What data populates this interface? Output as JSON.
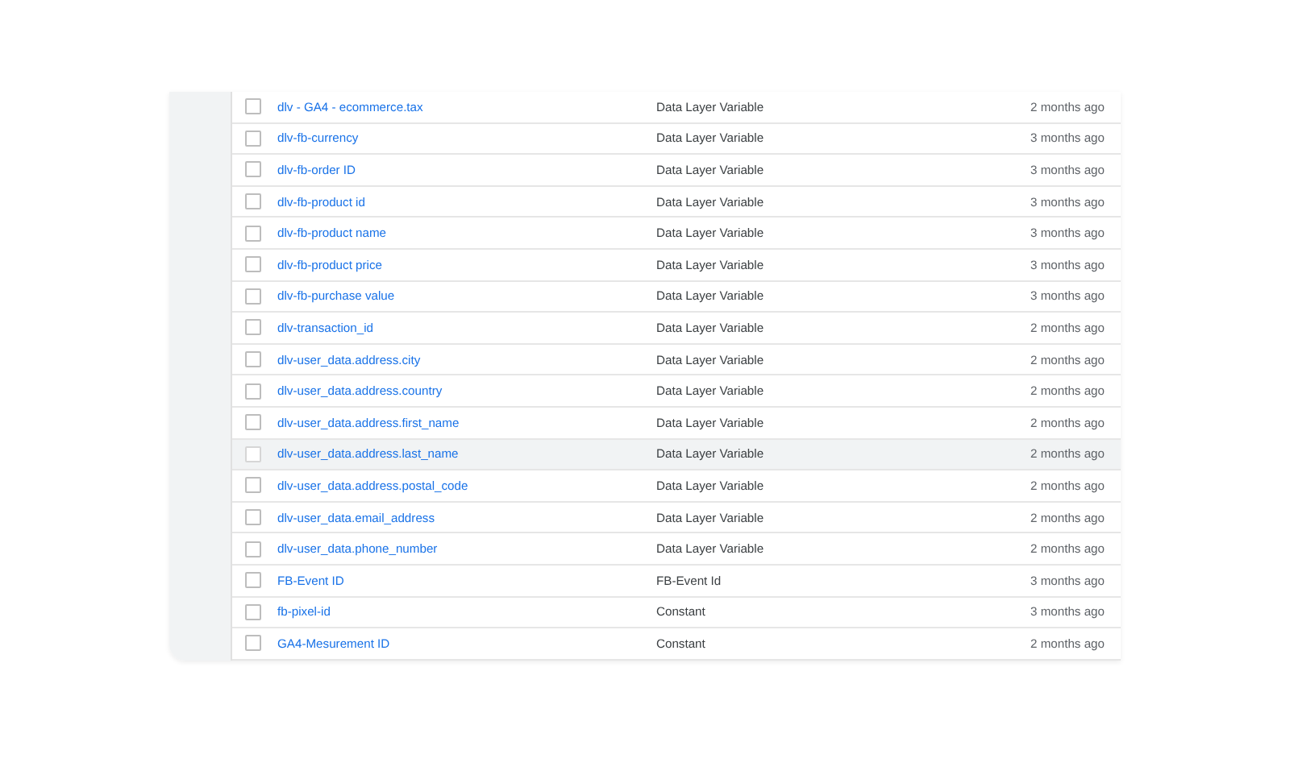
{
  "variables": [
    {
      "name": "dlv - GA4 - ecommerce.tax",
      "type": "Data Layer Variable",
      "edited": "2 months ago",
      "checked": false,
      "highlighted": false
    },
    {
      "name": "dlv-fb-currency",
      "type": "Data Layer Variable",
      "edited": "3 months ago",
      "checked": false,
      "highlighted": false
    },
    {
      "name": "dlv-fb-order ID",
      "type": "Data Layer Variable",
      "edited": "3 months ago",
      "checked": false,
      "highlighted": false
    },
    {
      "name": "dlv-fb-product id",
      "type": "Data Layer Variable",
      "edited": "3 months ago",
      "checked": false,
      "highlighted": false
    },
    {
      "name": "dlv-fb-product name",
      "type": "Data Layer Variable",
      "edited": "3 months ago",
      "checked": false,
      "highlighted": false
    },
    {
      "name": "dlv-fb-product price",
      "type": "Data Layer Variable",
      "edited": "3 months ago",
      "checked": false,
      "highlighted": false
    },
    {
      "name": "dlv-fb-purchase value",
      "type": "Data Layer Variable",
      "edited": "3 months ago",
      "checked": false,
      "highlighted": false
    },
    {
      "name": "dlv-transaction_id",
      "type": "Data Layer Variable",
      "edited": "2 months ago",
      "checked": false,
      "highlighted": false
    },
    {
      "name": "dlv-user_data.address.city",
      "type": "Data Layer Variable",
      "edited": "2 months ago",
      "checked": false,
      "highlighted": false
    },
    {
      "name": "dlv-user_data.address.country",
      "type": "Data Layer Variable",
      "edited": "2 months ago",
      "checked": false,
      "highlighted": false
    },
    {
      "name": "dlv-user_data.address.first_name",
      "type": "Data Layer Variable",
      "edited": "2 months ago",
      "checked": false,
      "highlighted": false
    },
    {
      "name": "dlv-user_data.address.last_name",
      "type": "Data Layer Variable",
      "edited": "2 months ago",
      "checked": false,
      "highlighted": true
    },
    {
      "name": "dlv-user_data.address.postal_code",
      "type": "Data Layer Variable",
      "edited": "2 months ago",
      "checked": false,
      "highlighted": false
    },
    {
      "name": "dlv-user_data.email_address",
      "type": "Data Layer Variable",
      "edited": "2 months ago",
      "checked": false,
      "highlighted": false
    },
    {
      "name": "dlv-user_data.phone_number",
      "type": "Data Layer Variable",
      "edited": "2 months ago",
      "checked": false,
      "highlighted": false
    },
    {
      "name": "FB-Event ID",
      "type": "FB-Event Id",
      "edited": "3 months ago",
      "checked": false,
      "highlighted": false
    },
    {
      "name": "fb-pixel-id",
      "type": "Constant",
      "edited": "3 months ago",
      "checked": false,
      "highlighted": false
    },
    {
      "name": "GA4-Mesurement ID",
      "type": "Constant",
      "edited": "2 months ago",
      "checked": false,
      "highlighted": false
    }
  ]
}
